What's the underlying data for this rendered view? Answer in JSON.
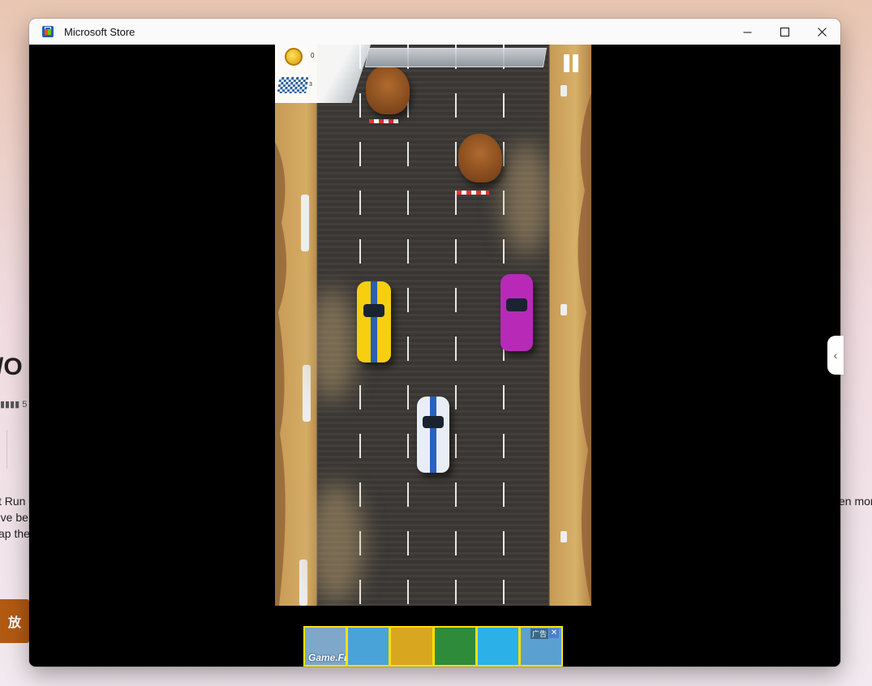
{
  "window": {
    "title": "Microsoft Store",
    "minimize_label": "",
    "maximize_label": "",
    "close_label": ""
  },
  "background_page": {
    "title_fragment": "/O",
    "description_lines": [
      "t Run",
      "'ve be",
      "ap the"
    ],
    "right_fragment": "en mor",
    "play_button_fragment": "放"
  },
  "game": {
    "coins": "0",
    "lap": "3"
  },
  "ad": {
    "brand": "Game.Fm",
    "badge": "广告",
    "close": "✕",
    "tile_colors": [
      "#7ea7c9",
      "#4aa3d8",
      "#d9a620",
      "#2e8b3a",
      "#2bb0e8",
      "#5aa0d0"
    ]
  },
  "colors": {
    "window_bg": "#000000",
    "titlebar": "#fafafa",
    "ad_border": "#ffe000"
  }
}
